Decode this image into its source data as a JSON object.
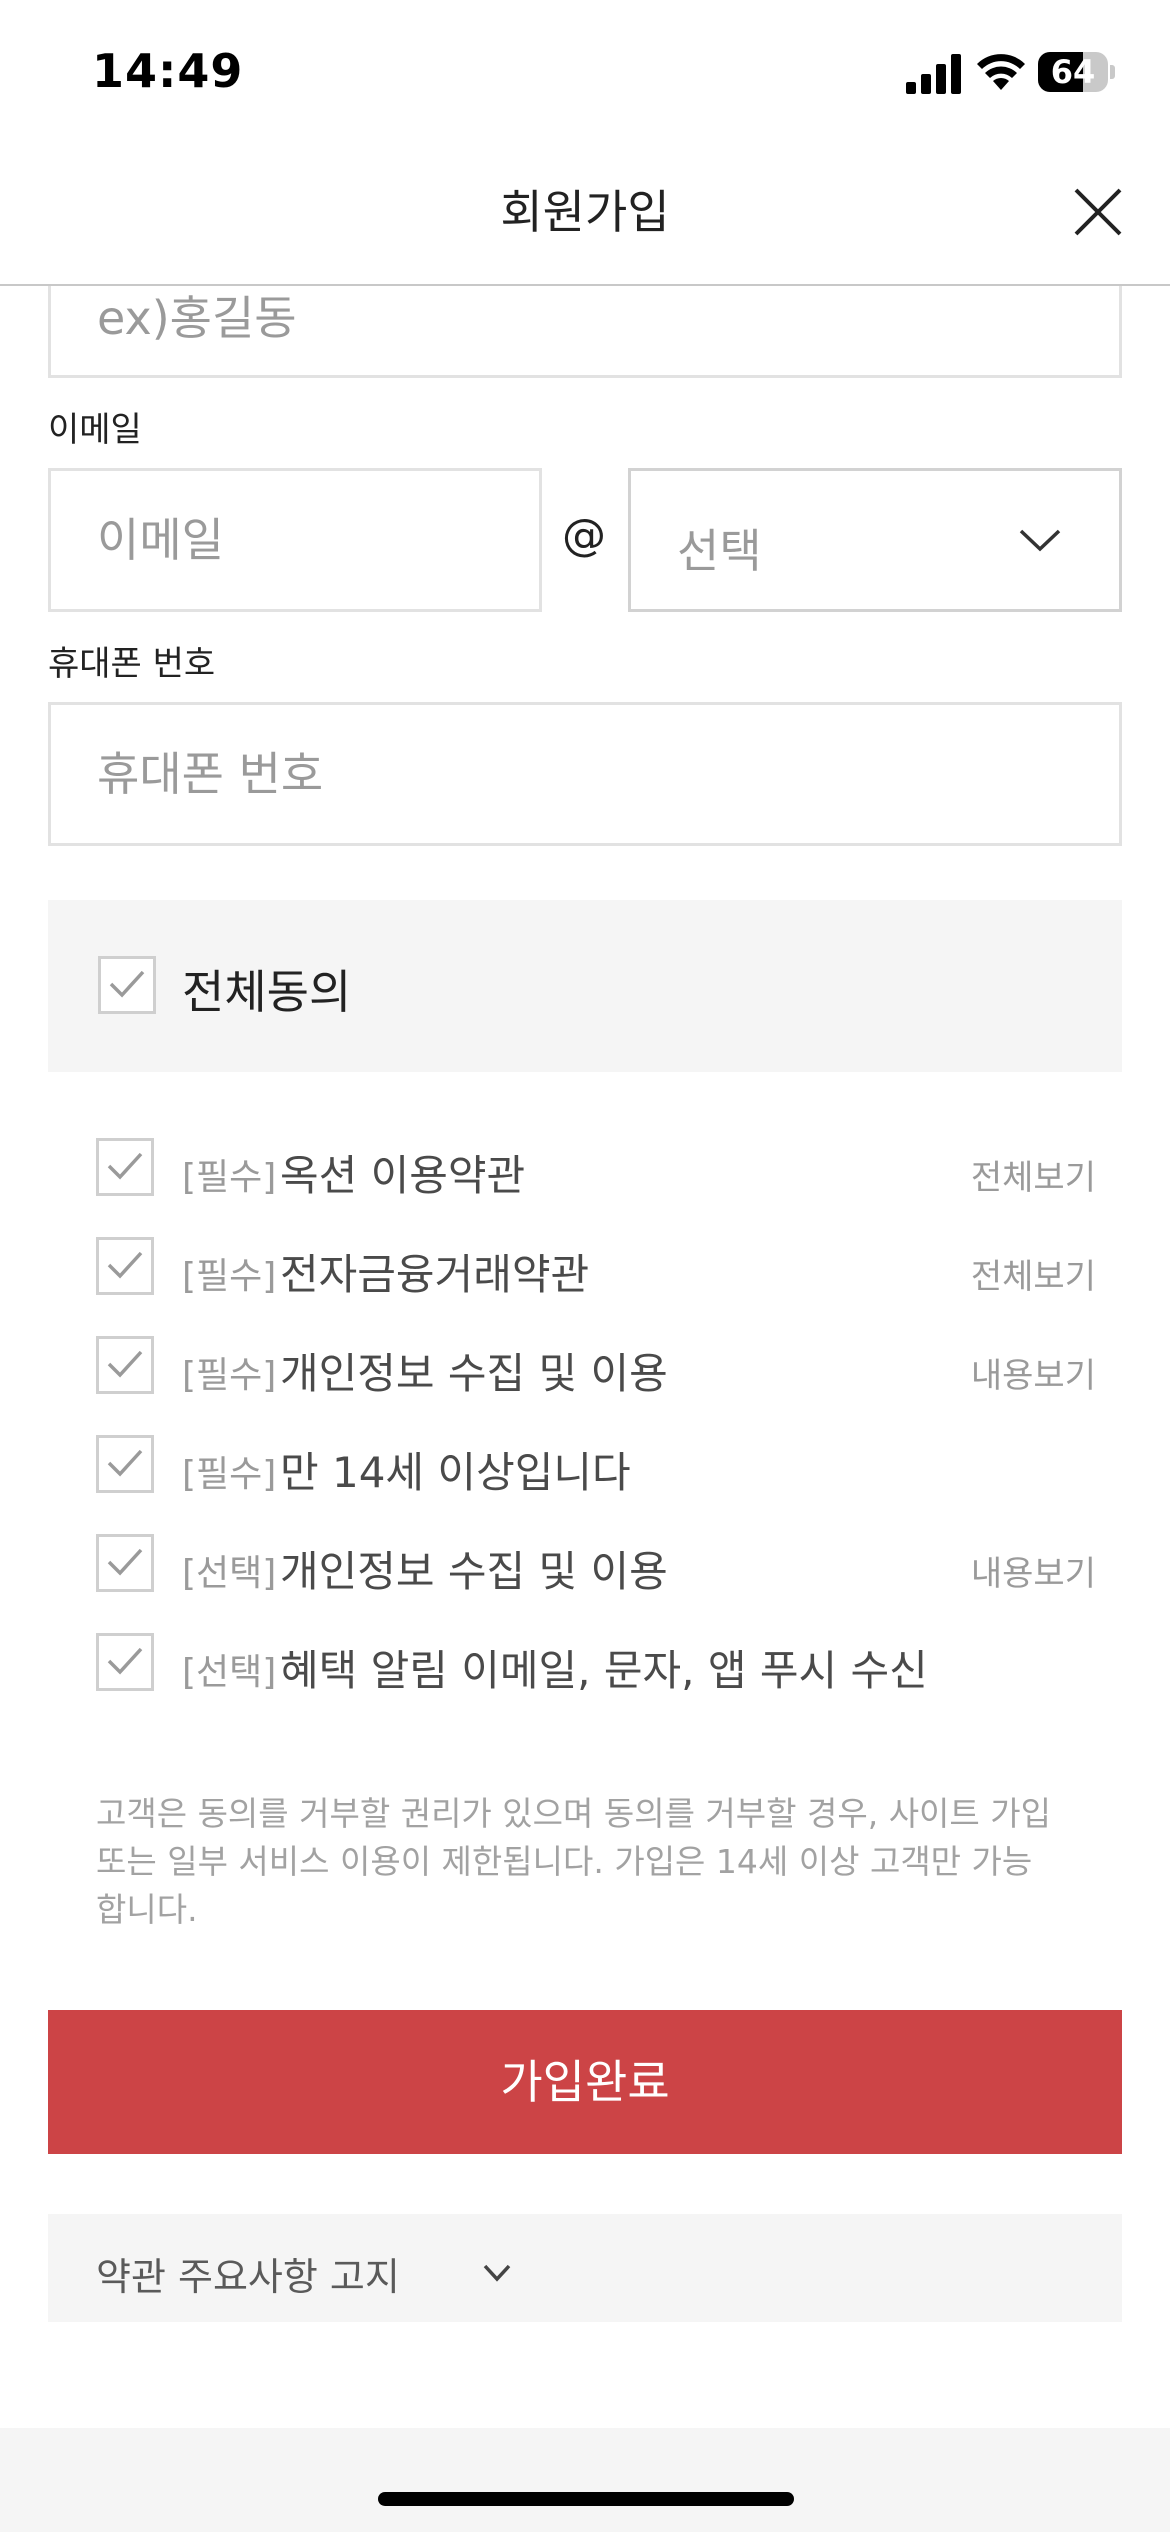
{
  "status_bar": {
    "time": "14:49",
    "battery_level": "64"
  },
  "header": {
    "title": "회원가입",
    "close_icon": "close-icon"
  },
  "form": {
    "name_placeholder": "ex)홍길동",
    "email_label": "이메일",
    "email_placeholder": "이메일",
    "at_sign": "@",
    "domain_select_value": "선택",
    "phone_label": "휴대폰 번호",
    "phone_placeholder": "휴대폰 번호"
  },
  "agreement": {
    "all_label": "전체동의",
    "all_checked": true,
    "items": [
      {
        "tag": "[필수]",
        "text": "옥션 이용약관",
        "link": "전체보기",
        "checked": true
      },
      {
        "tag": "[필수]",
        "text": "전자금융거래약관",
        "link": "전체보기",
        "checked": true
      },
      {
        "tag": "[필수]",
        "text": "개인정보 수집 및 이용",
        "link": "내용보기",
        "checked": true
      },
      {
        "tag": "[필수]",
        "text": "만 14세 이상입니다",
        "link": "",
        "checked": true
      },
      {
        "tag": "[선택]",
        "text": "개인정보 수집 및 이용",
        "link": "내용보기",
        "checked": true
      },
      {
        "tag": "[선택]",
        "text": "혜택 알림 이메일, 문자, 앱 푸시 수신",
        "link": "",
        "checked": true
      }
    ],
    "notice_lines": [
      "고객은 동의를 거부할 권리가 있으며 동의를 거부할 경우, 사이트 가입",
      "또는 일부 서비스 이용이 제한됩니다. 가입은 14세 이상 고객만 가능",
      "합니다."
    ]
  },
  "submit_label": "가입완료",
  "terms_notice_label": "약관 주요사항 고지",
  "colors": {
    "primary_button": "#cc4446",
    "panel_bg": "#f5f5f5",
    "check_mark": "#9a9a9a"
  }
}
